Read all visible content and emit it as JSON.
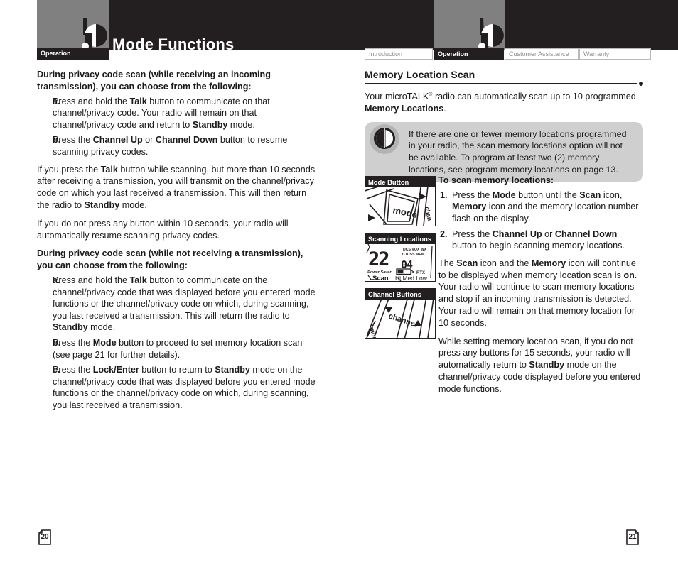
{
  "header": {
    "title": "Mode Functions",
    "left_tab_label": "Operation",
    "logo_icon": "walkie-talkie-icon"
  },
  "tabs": [
    {
      "label": "Introduction",
      "active": false
    },
    {
      "label": "Operation",
      "active": true
    },
    {
      "label": "Customer Assistance",
      "active": false
    },
    {
      "label": "Warranty",
      "active": false
    }
  ],
  "left_page": {
    "page_number": "20",
    "section1": {
      "lead": "During privacy code scan (while receiving an incoming transmission), you can choose from the following:",
      "steps": [
        {
          "marker": "a.",
          "html": "Press and hold the <b>Talk</b> button to communicate on that channel/privacy code. Your radio will remain on that channel/privacy code and return to <b>Standby</b> mode."
        },
        {
          "marker": "b.",
          "html": "Press the <b>Channel Up</b> or <b>Channel Down</b> button to resume scanning privacy codes."
        }
      ]
    },
    "para1": "If you press the <b>Talk</b> button while scanning, but more than 10 seconds after receiving a transmission, you will transmit on the channel/privacy code on which you last received a transmission. This will then return the radio to <b>Standby</b> mode.",
    "para2": "If you do not press any button within 10 seconds, your radio will automatically resume scanning privacy codes.",
    "section2": {
      "lead": "During privacy code scan (while not receiving a transmission), you can choose from the following:",
      "steps": [
        {
          "marker": "a.",
          "html": "Press and hold the <b>Talk</b> button to communicate on the channel/privacy code that was displayed before you entered mode functions or the channel/privacy code on which, during scanning, you last received a transmission. This will return the radio to <b>Standby</b> mode."
        },
        {
          "marker": "b.",
          "html": "Press the <b>Mode</b> button to proceed to set memory location scan (see page 21 for further details)."
        },
        {
          "marker": "c.",
          "html": "Press the <b>Lock/Enter</b> button to return to <b>Standby</b> mode on the channel/privacy code that was displayed before you entered mode functions or the channel/privacy code on which, during scanning, you last received a transmission."
        }
      ]
    }
  },
  "right_page": {
    "page_number": "21",
    "section_title": "Memory Location Scan",
    "intro": "Your microTALK<sup class=\"sup\">&reg;</sup> radio can automatically scan up to 10 programmed <b>Memory Locations</b>.",
    "callout": {
      "icon": "note-circle-icon",
      "text": "If there are one or fewer memory locations programmed in your radio, the scan memory locations option will not be available. To program at least two (2) memory locations, see program memory locations on page 13."
    },
    "figures": [
      {
        "title": "Mode Button",
        "art": "mode-button-illustration",
        "label": "mode"
      },
      {
        "title": "Scanning Locations",
        "art": "lcd-display-illustration"
      },
      {
        "title": "Channel Buttons",
        "art": "channel-buttons-illustration",
        "label": "channel"
      }
    ],
    "lcd": {
      "main_digits": "22",
      "sub_digits": "04",
      "indicators_top": "DCS VOX WX",
      "indicators_second": "CTCSS MEM",
      "power_saver": "Power Saver",
      "rtx": "RTX",
      "scan": "Scan",
      "levels": "Hi Med Low"
    },
    "instructions_lead": "To scan memory locations:",
    "instructions": [
      {
        "marker": "1.",
        "html": "Press the <b>Mode</b> button until the <b>Scan</b> icon, <b>Memory</b> icon and the memory location number flash on the display."
      },
      {
        "marker": "2.",
        "html": "Press the <b>Channel Up</b> or <b>Channel Down</b> button to begin scanning memory locations."
      }
    ],
    "para1": "The <b>Scan</b> icon and the <b>Memory</b> icon will continue to be displayed when memory location scan is <b>on</b>. Your radio will continue to scan memory locations and stop if an incoming transmission is detected. Your radio will remain on that memory location for 10 seconds.",
    "para2": "While setting memory location scan, if you do not press any buttons for 15 seconds, your radio will automatically return to <b>Standby</b> mode on the channel/privacy code displayed before you entered mode functions."
  },
  "colors": {
    "header_bg": "#231f20",
    "gray_panel": "#808080",
    "callout_bg": "#cfcfcf",
    "text": "#1a1a1a",
    "tab_inactive_text": "#8f8f8f"
  }
}
